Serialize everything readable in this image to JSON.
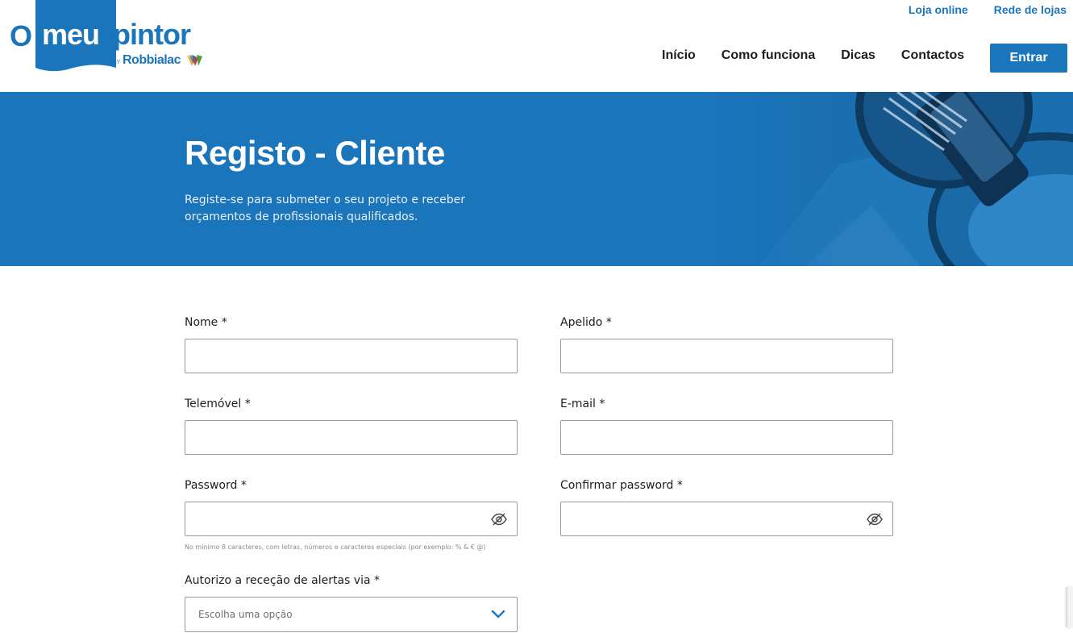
{
  "header": {
    "logo": {
      "o": "O",
      "meu": "meu",
      "pintor": "pintor",
      "by": "BY",
      "brand": "Robbialac"
    },
    "top_links": [
      "Loja online",
      "Rede de lojas"
    ],
    "nav": [
      "Início",
      "Como funciona",
      "Dicas",
      "Contactos"
    ],
    "login_button": "Entrar"
  },
  "hero": {
    "title": "Registo - Cliente",
    "subtitle": "Registe-se para submeter o seu projeto e receber orçamentos de profissionais qualificados."
  },
  "form": {
    "nome": {
      "label": "Nome *",
      "value": ""
    },
    "apelido": {
      "label": "Apelido *",
      "value": ""
    },
    "telemovel": {
      "label": "Telemóvel *",
      "value": ""
    },
    "email": {
      "label": "E-mail *",
      "value": ""
    },
    "password": {
      "label": "Password *",
      "value": "",
      "hint": "No mínimo 8 caracteres, com letras, números e caracteres especiais (por exemplo: % & € @)"
    },
    "confirm_password": {
      "label": "Confirmar password *",
      "value": ""
    },
    "alerts": {
      "label": "Autorizo a receção de alertas via *",
      "selected": "Escolha uma opção"
    }
  },
  "colors": {
    "brand_blue": "#1b75bb",
    "text_dark": "#1d1d1d",
    "border": "#9a9a9a"
  },
  "icons": [
    "eye-slash-icon",
    "chevron-down-icon",
    "paint-can-icon"
  ]
}
